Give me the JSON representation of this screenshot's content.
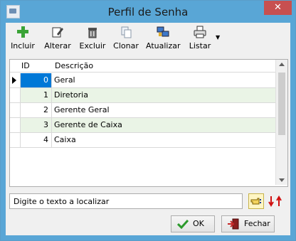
{
  "window": {
    "title": "Perfil de Senha",
    "close_glyph": "✕"
  },
  "toolbar": {
    "buttons": [
      {
        "label": "Incluir",
        "icon": "plus-icon",
        "color": "#3aa336"
      },
      {
        "label": "Alterar",
        "icon": "edit-pencil-icon"
      },
      {
        "label": "Excluir",
        "icon": "trash-bin-icon"
      },
      {
        "label": "Clonar",
        "icon": "copy-documents-icon"
      },
      {
        "label": "Atualizar",
        "icon": "refresh-computers-icon"
      },
      {
        "label": "Listar",
        "icon": "printer-icon"
      }
    ],
    "dropdown_glyph": "▼"
  },
  "grid": {
    "columns": [
      "ID",
      "Descrição"
    ],
    "rows": [
      {
        "id": "0",
        "desc": "Geral"
      },
      {
        "id": "1",
        "desc": "Diretoria"
      },
      {
        "id": "2",
        "desc": "Gerente Geral"
      },
      {
        "id": "3",
        "desc": "Gerente de Caixa"
      },
      {
        "id": "4",
        "desc": "Caixa"
      }
    ],
    "selected_row": 0
  },
  "search": {
    "value": "Digite o texto a localizar"
  },
  "footer": {
    "ok_label": "OK",
    "close_label": "Fechar"
  },
  "colors": {
    "titlebar": "#59a6d6",
    "selection": "#0078d7",
    "alt_row": "#eaf4e6",
    "close": "#c75050"
  }
}
